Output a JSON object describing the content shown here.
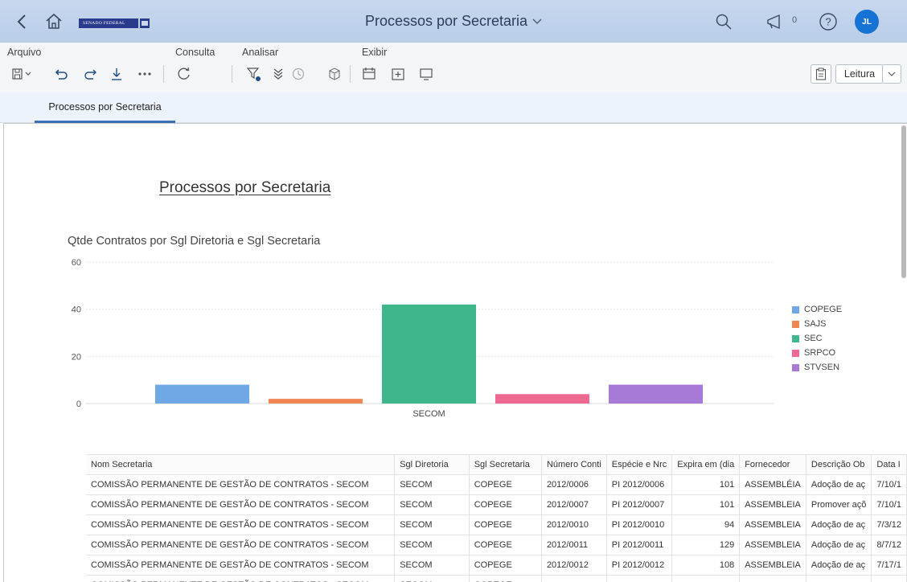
{
  "shell": {
    "title": "Processos por Secretaria",
    "brand_text": "SENADO FEDERAL",
    "notification_count": "0",
    "user_initials": "JL",
    "colors": {
      "header_bg": "#c7d8ee",
      "avatar": "#1673d6"
    },
    "icons": [
      "back-icon",
      "home-icon",
      "search-icon",
      "announcement-icon",
      "help-icon"
    ]
  },
  "toolbar": {
    "groups": {
      "arquivo": "Arquivo",
      "consulta": "Consulta",
      "analisar": "Analisar",
      "exibir": "Exibir"
    },
    "mode_label": "Leitura"
  },
  "tabs": [
    {
      "label": "Processos por Secretaria",
      "active": true
    }
  ],
  "report": {
    "title": "Processos por Secretaria"
  },
  "chart_data": {
    "type": "bar",
    "title": "Qtde Contratos por Sgl Diretoria e Sgl Secretaria",
    "categories": [
      "SECOM"
    ],
    "series": [
      {
        "name": "COPEGE",
        "values": [
          8
        ],
        "color": "#6fa8e4"
      },
      {
        "name": "SAJS",
        "values": [
          2
        ],
        "color": "#ef8654"
      },
      {
        "name": "SEC",
        "values": [
          42
        ],
        "color": "#3fb68b"
      },
      {
        "name": "SRPCO",
        "values": [
          4
        ],
        "color": "#ee6a92"
      },
      {
        "name": "STVSEN",
        "values": [
          8
        ],
        "color": "#a87ad8"
      }
    ],
    "ylim": [
      0,
      60
    ],
    "yticks": [
      "0",
      "20",
      "40",
      "60"
    ],
    "grid": true,
    "legend": "right"
  },
  "table": {
    "columns": [
      "Nom Secretaria",
      "Sgl Diretoria",
      "Sgl Secretaria",
      "Número Conti",
      "Espécie e Nrc",
      "Expira em (dia",
      "Fornecedor",
      "Descrição Ob",
      "Data I"
    ],
    "rows": [
      [
        "COMISSÃO PERMANENTE DE GESTÃO DE CONTRATOS - SECOM",
        "SECOM",
        "COPEGE",
        "2012/0006",
        "PI 2012/0006",
        "101",
        "ASSEMBLÉIA",
        "Adoção de aç",
        "7/10/1"
      ],
      [
        "COMISSÃO PERMANENTE DE GESTÃO DE CONTRATOS - SECOM",
        "SECOM",
        "COPEGE",
        "2012/0007",
        "PI 2012/0007",
        "101",
        "ASSEMBLEIA",
        "Promover açõ",
        "7/10/1"
      ],
      [
        "COMISSÃO PERMANENTE DE GESTÃO DE CONTRATOS - SECOM",
        "SECOM",
        "COPEGE",
        "2012/0010",
        "PI 2012/0010",
        "94",
        "ASSEMBLEIA",
        "Adoção de aç",
        "7/3/12"
      ],
      [
        "COMISSÃO PERMANENTE DE GESTÃO DE CONTRATOS - SECOM",
        "SECOM",
        "COPEGE",
        "2012/0011",
        "PI 2012/0011",
        "129",
        "ASSEMBLEIA",
        "Adoção de aç",
        "8/7/12"
      ],
      [
        "COMISSÃO PERMANENTE DE GESTÃO DE CONTRATOS - SECOM",
        "SECOM",
        "COPEGE",
        "2012/0012",
        "PI 2012/0012",
        "108",
        "ASSEMBLEIA",
        "Adoção de aç",
        "7/17/1"
      ],
      [
        "COMISSÃO PERMANENTE DE GESTÃO DE CONTRATOS - SECOM",
        "SECOM",
        "COPEGE",
        "",
        "",
        "",
        "",
        "",
        ""
      ]
    ]
  }
}
